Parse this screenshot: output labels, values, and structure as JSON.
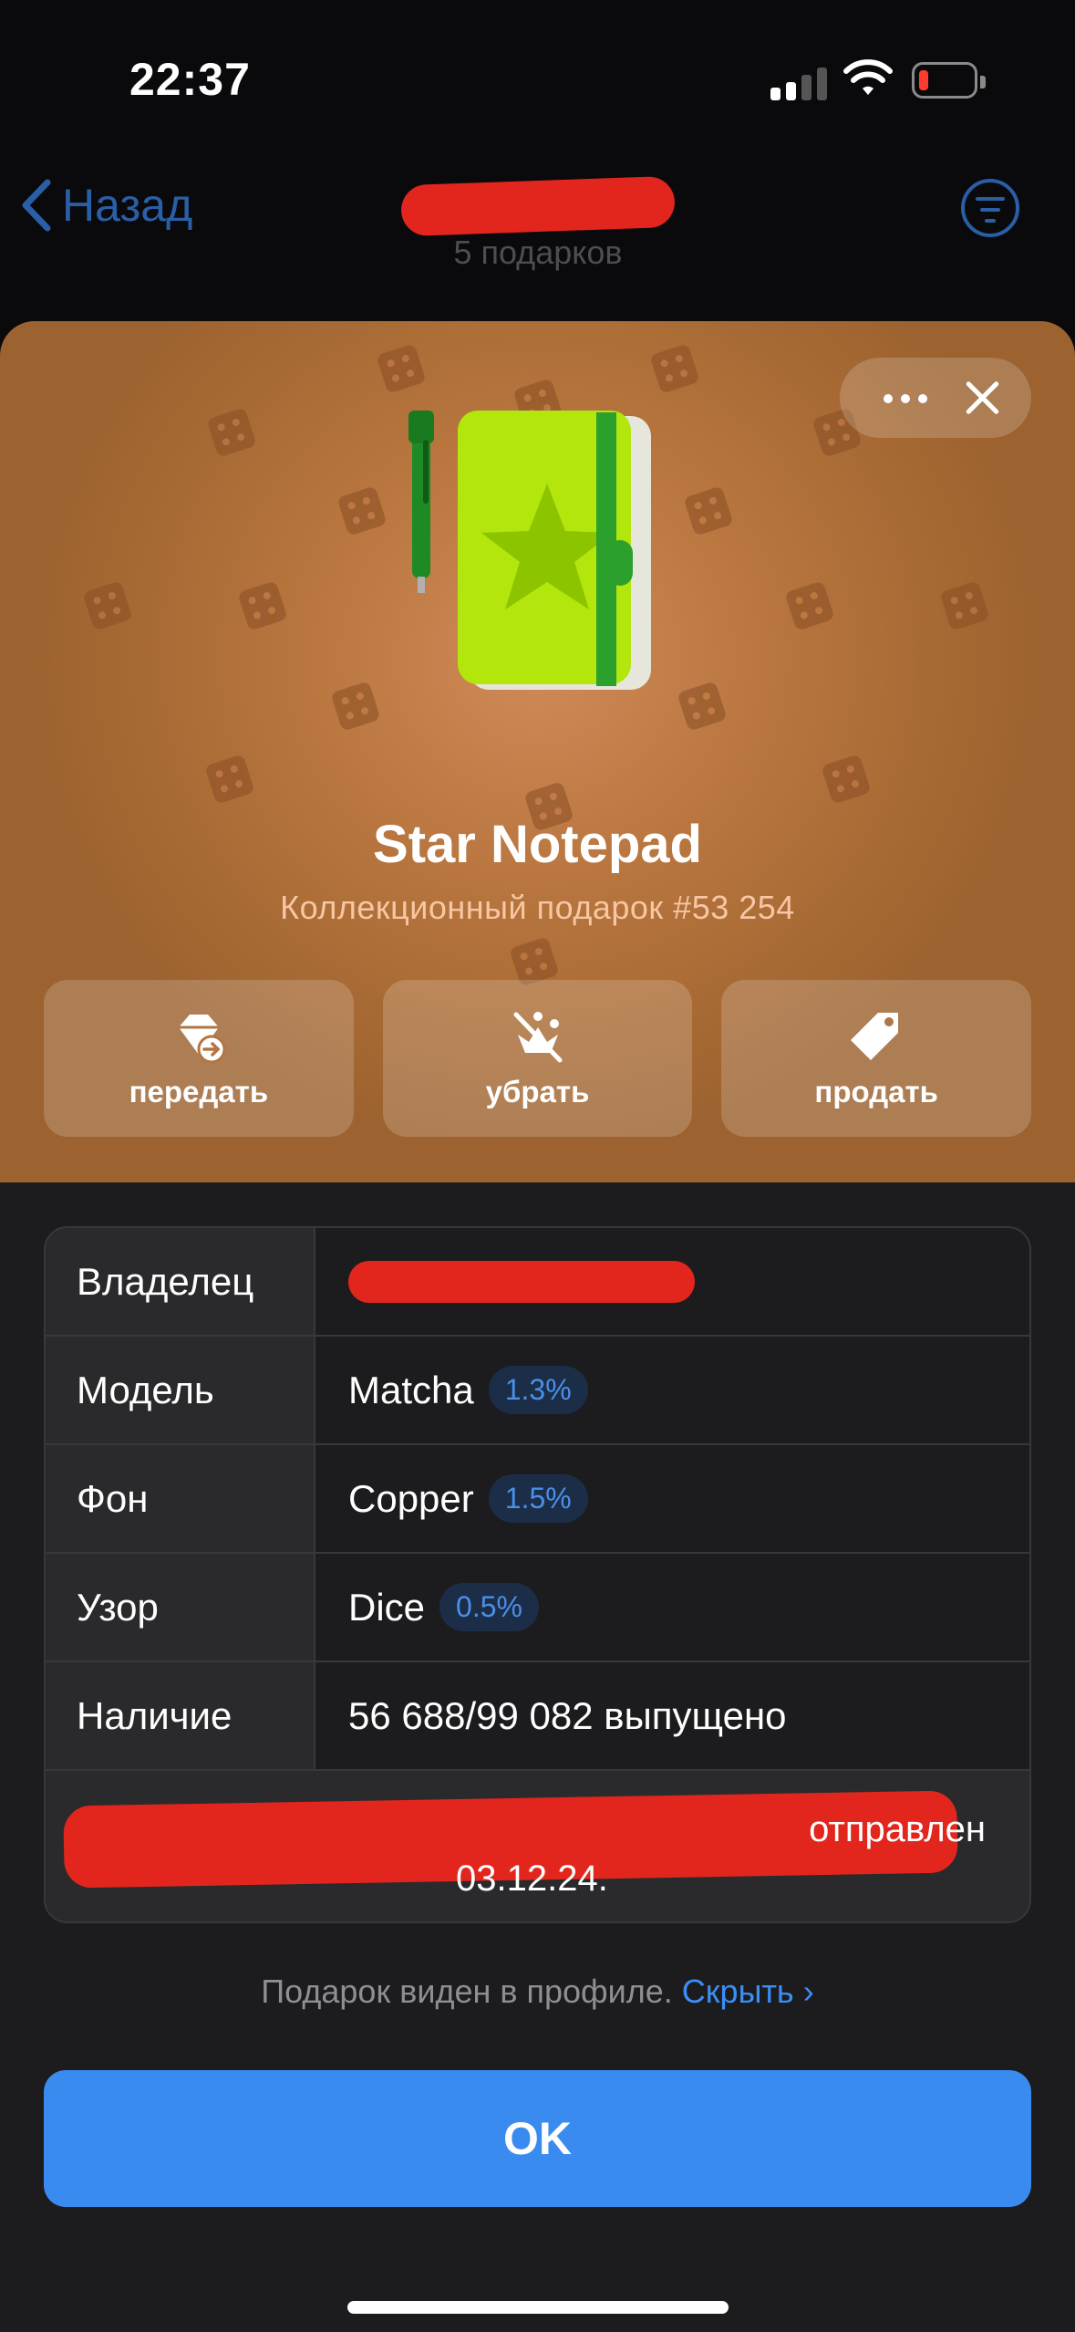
{
  "status_bar": {
    "time": "22:37",
    "battery_color": "#ff3b30"
  },
  "nav": {
    "back_label": "Назад",
    "subtitle": "5 подарков",
    "filter_icon": "filter-icon"
  },
  "gift": {
    "title": "Star Notepad",
    "subtitle": "Коллекционный подарок #53 254",
    "background_color": "#b9763f"
  },
  "actions": [
    {
      "label": "передать",
      "icon": "gift-transfer-icon"
    },
    {
      "label": "убрать",
      "icon": "unpin-crown-icon"
    },
    {
      "label": "продать",
      "icon": "price-tag-icon"
    }
  ],
  "info_table": {
    "rows": [
      {
        "label": "Владелец",
        "value": ""
      },
      {
        "label": "Модель",
        "value": "Matcha",
        "badge": "1.3%"
      },
      {
        "label": "Фон",
        "value": "Copper",
        "badge": "1.5%"
      },
      {
        "label": "Узор",
        "value": "Dice",
        "badge": "0.5%"
      },
      {
        "label": "Наличие",
        "value": "56 688/99 082 выпущено"
      }
    ],
    "footer_text": "отправлен",
    "footer_date": "03.12.24."
  },
  "visibility": {
    "text": "Подарок виден в профиле.",
    "link": "Скрыть"
  },
  "ok_button": {
    "label": "OK"
  },
  "colors": {
    "accent": "#3a8bf0",
    "badge_text": "#4a8fe8"
  }
}
